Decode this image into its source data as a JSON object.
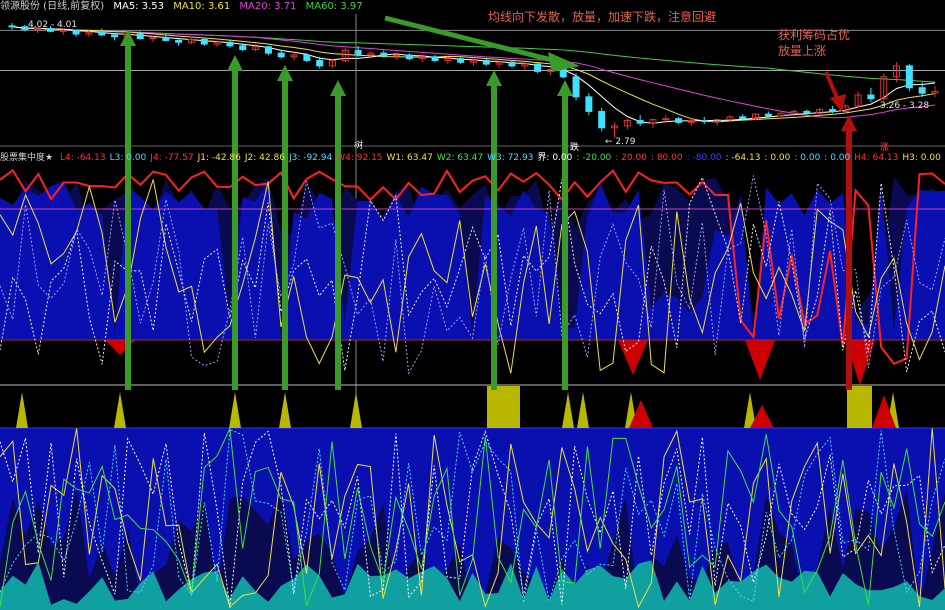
{
  "colors": {
    "ma5": "#ffffff",
    "ma10": "#f0e040",
    "ma20": "#e040e0",
    "ma60": "#40d040",
    "upCandle": "#e03030",
    "downCandle": "#40e0ff",
    "annotation": "#e8604a",
    "arrowGreen": "#3a9a2a",
    "arrowRed": "#b01010",
    "fillBlue": "#0a10b0",
    "fillDarkBlue": "#0a0a50",
    "fillRed": "#cc0000",
    "fillYellow": "#b8b800",
    "fillCyan": "#10a0a0"
  },
  "top": {
    "stock_name": "领源股份 (日线,前复权)",
    "ma5_label": "MA5: 3.53",
    "ma10_label": "MA10: 3.61",
    "ma20_label": "MA20: 3.71",
    "ma60_label": "MA60: 3.97",
    "price_tag_high": "4.02 - 4.01",
    "price_tag_low": "← 2.79",
    "price_tag_right": "3.26 - 3.28",
    "marker_fall": "跌",
    "marker_rise": "涨",
    "marker_tree": "树"
  },
  "annotations": {
    "top_center": "均线向下发散，放量，加速下跌，注意回避",
    "right_line1": "获利筹码占优",
    "right_line2": "放量上涨"
  },
  "indicator": {
    "name": "股票集中度★",
    "items": [
      {
        "label": "L4: -64.13",
        "color": "#ff3030"
      },
      {
        "label": "L3: 0.00",
        "color": "#40e0ff"
      },
      {
        "label": "J4: -77.57",
        "color": "#ff3030"
      },
      {
        "label": "J1: -42.86",
        "color": "#f0e040"
      },
      {
        "label": "J2: 42.86",
        "color": "#f0e040"
      },
      {
        "label": "J3: -92.94",
        "color": "#40e0ff"
      },
      {
        "label": "W4: 92.15",
        "color": "#ff3030"
      },
      {
        "label": "W1: 63.47",
        "color": "#f0e040"
      },
      {
        "label": "W2: 63.47",
        "color": "#40e040"
      },
      {
        "label": "W3: 72.93",
        "color": "#40e0ff"
      },
      {
        "label": "界: 0.00",
        "color": "#ffffff"
      },
      {
        "label": ": -20.00",
        "color": "#40e040"
      },
      {
        "label": ": 20.00",
        "color": "#ff3030"
      },
      {
        "label": ": 80.00",
        "color": "#ff3030"
      },
      {
        "label": ": -80.00",
        "color": "#4040ff"
      },
      {
        "label": ": -64.13",
        "color": "#f0e040"
      },
      {
        "label": ": 0.00",
        "color": "#f0e040"
      },
      {
        "label": ": 0.00",
        "color": "#40e0ff"
      },
      {
        "label": ": 0.00",
        "color": "#40e0ff"
      },
      {
        "label": "H4: 64.13",
        "color": "#ff3030"
      },
      {
        "label": "H3: 0.00",
        "color": "#f0e040"
      }
    ]
  },
  "chart_data": {
    "type": "line",
    "price_ohlc": [
      [
        4.02,
        4.05,
        3.98,
        4.01
      ],
      [
        4.01,
        4.03,
        3.96,
        3.98
      ],
      [
        3.98,
        4.0,
        3.94,
        3.99
      ],
      [
        3.99,
        4.02,
        3.95,
        3.96
      ],
      [
        3.96,
        3.99,
        3.92,
        3.97
      ],
      [
        3.97,
        3.98,
        3.9,
        3.93
      ],
      [
        3.93,
        3.97,
        3.9,
        3.95
      ],
      [
        3.95,
        3.99,
        3.91,
        3.92
      ],
      [
        3.92,
        3.94,
        3.86,
        3.9
      ],
      [
        3.9,
        3.95,
        3.88,
        3.93
      ],
      [
        3.93,
        3.96,
        3.87,
        3.88
      ],
      [
        3.88,
        3.91,
        3.84,
        3.89
      ],
      [
        3.89,
        3.93,
        3.85,
        3.86
      ],
      [
        3.86,
        3.88,
        3.8,
        3.84
      ],
      [
        3.84,
        3.9,
        3.82,
        3.87
      ],
      [
        3.87,
        3.89,
        3.8,
        3.82
      ],
      [
        3.82,
        3.86,
        3.79,
        3.84
      ],
      [
        3.84,
        3.86,
        3.78,
        3.8
      ],
      [
        3.8,
        3.83,
        3.74,
        3.76
      ],
      [
        3.76,
        3.82,
        3.74,
        3.79
      ],
      [
        3.79,
        3.8,
        3.7,
        3.72
      ],
      [
        3.72,
        3.76,
        3.66,
        3.68
      ],
      [
        3.68,
        3.73,
        3.64,
        3.7
      ],
      [
        3.7,
        3.72,
        3.62,
        3.64
      ],
      [
        3.64,
        3.68,
        3.55,
        3.58
      ],
      [
        3.58,
        3.66,
        3.56,
        3.64
      ],
      [
        3.64,
        3.78,
        3.62,
        3.75
      ],
      [
        3.75,
        3.8,
        3.68,
        3.7
      ],
      [
        3.7,
        3.74,
        3.66,
        3.72
      ],
      [
        3.72,
        3.75,
        3.67,
        3.69
      ],
      [
        3.69,
        3.72,
        3.65,
        3.7
      ],
      [
        3.7,
        3.72,
        3.64,
        3.66
      ],
      [
        3.66,
        3.7,
        3.62,
        3.68
      ],
      [
        3.68,
        3.7,
        3.62,
        3.64
      ],
      [
        3.64,
        3.68,
        3.6,
        3.66
      ],
      [
        3.66,
        3.68,
        3.6,
        3.62
      ],
      [
        3.62,
        3.66,
        3.58,
        3.64
      ],
      [
        3.64,
        3.66,
        3.58,
        3.6
      ],
      [
        3.6,
        3.64,
        3.56,
        3.62
      ],
      [
        3.62,
        3.64,
        3.56,
        3.58
      ],
      [
        3.58,
        3.62,
        3.54,
        3.6
      ],
      [
        3.6,
        3.61,
        3.5,
        3.52
      ],
      [
        3.52,
        3.56,
        3.48,
        3.54
      ],
      [
        3.54,
        3.56,
        3.44,
        3.46
      ],
      [
        3.46,
        3.5,
        3.2,
        3.24
      ],
      [
        3.24,
        3.28,
        3.04,
        3.08
      ],
      [
        3.08,
        3.12,
        2.86,
        2.9
      ],
      [
        2.9,
        2.96,
        2.79,
        2.92
      ],
      [
        2.92,
        3.0,
        2.88,
        2.98
      ],
      [
        2.98,
        3.04,
        2.92,
        2.95
      ],
      [
        2.95,
        3.0,
        2.9,
        2.99
      ],
      [
        2.99,
        3.04,
        2.95,
        3.0
      ],
      [
        3.0,
        3.02,
        2.94,
        2.96
      ],
      [
        2.96,
        3.0,
        2.92,
        2.98
      ],
      [
        2.98,
        3.02,
        2.94,
        2.97
      ],
      [
        2.97,
        3.0,
        2.93,
        2.99
      ],
      [
        2.99,
        3.04,
        2.96,
        3.02
      ],
      [
        3.02,
        3.05,
        2.98,
        3.0
      ],
      [
        3.0,
        3.06,
        2.98,
        3.05
      ],
      [
        3.05,
        3.08,
        3.01,
        3.03
      ],
      [
        3.03,
        3.07,
        3.0,
        3.06
      ],
      [
        3.06,
        3.1,
        3.02,
        3.08
      ],
      [
        3.08,
        3.1,
        3.04,
        3.06
      ],
      [
        3.06,
        3.12,
        3.04,
        3.1
      ],
      [
        3.1,
        3.14,
        3.06,
        3.08
      ],
      [
        3.08,
        3.16,
        3.06,
        3.14
      ],
      [
        3.14,
        3.3,
        3.12,
        3.26
      ],
      [
        3.26,
        3.34,
        3.18,
        3.22
      ],
      [
        3.22,
        3.5,
        3.2,
        3.46
      ],
      [
        3.46,
        3.62,
        3.4,
        3.58
      ],
      [
        3.58,
        3.6,
        3.3,
        3.34
      ],
      [
        3.34,
        3.4,
        3.24,
        3.28
      ],
      [
        3.28,
        3.36,
        3.24,
        3.3
      ]
    ],
    "ma_levels": {
      "MA5": 3.53,
      "MA10": 3.61,
      "MA20": 3.71,
      "MA60": 3.97
    }
  }
}
